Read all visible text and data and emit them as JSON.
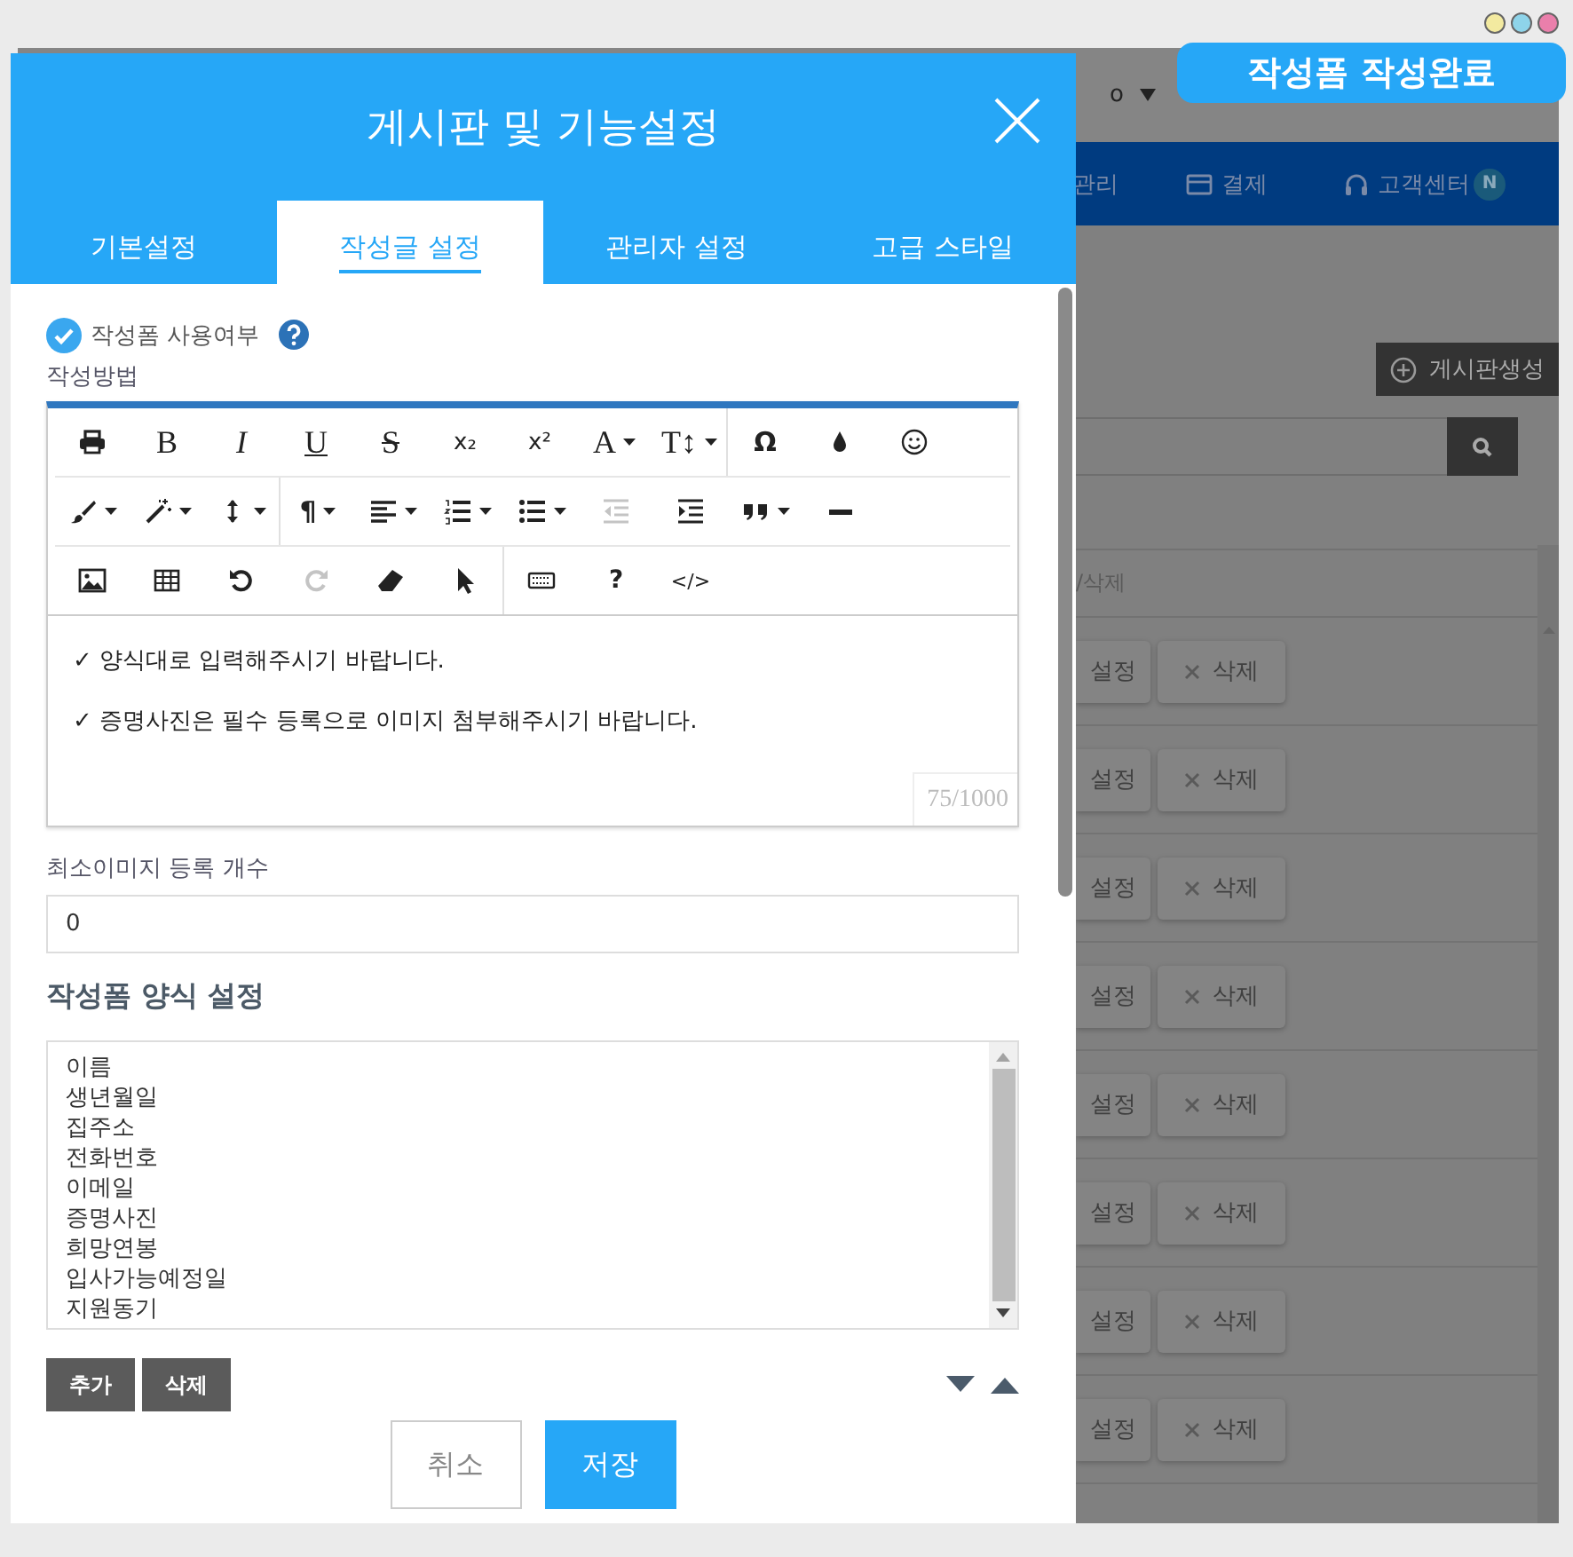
{
  "window_dots": [
    {
      "color": "#f3eaa0"
    },
    {
      "color": "#8ed4ea"
    },
    {
      "color": "#ea7fab"
    }
  ],
  "status_badge": "작성폼 작성완료",
  "background_page": {
    "top_text": "o",
    "nav": [
      {
        "label": "관리"
      },
      {
        "label": "결제"
      },
      {
        "label": "고객센터",
        "badge": "N"
      }
    ],
    "create_button": "게시판생성",
    "table_header": "/삭제",
    "rows": [
      {
        "edit": "설정",
        "delete": "삭제"
      },
      {
        "edit": "설정",
        "delete": "삭제"
      },
      {
        "edit": "설정",
        "delete": "삭제"
      },
      {
        "edit": "설정",
        "delete": "삭제"
      },
      {
        "edit": "설정",
        "delete": "삭제"
      },
      {
        "edit": "설정",
        "delete": "삭제"
      },
      {
        "edit": "설정",
        "delete": "삭제"
      },
      {
        "edit": "설정",
        "delete": "삭제"
      }
    ]
  },
  "modal": {
    "title": "게시판 및 기능설정",
    "tabs": [
      {
        "label": "기본설정",
        "selected": false
      },
      {
        "label": "작성글 설정",
        "selected": true
      },
      {
        "label": "관리자 설정",
        "selected": false
      },
      {
        "label": "고급 스타일",
        "selected": false
      }
    ],
    "use_form": {
      "label": "작성폼 사용여부",
      "checked": true
    },
    "method_label": "작성방법",
    "toolbar": [
      [
        [
          {
            "kind": "icon",
            "dropdown": false,
            "disabled": false
          },
          {
            "kind": "glyph",
            "text": "B",
            "dropdown": false,
            "disabled": false
          },
          {
            "kind": "glyph",
            "text": "I",
            "dropdown": false,
            "disabled": false
          },
          {
            "kind": "glyph",
            "text": "U",
            "dropdown": false,
            "disabled": false
          },
          {
            "kind": "glyph",
            "text": "S",
            "dropdown": false,
            "disabled": false
          },
          {
            "kind": "glyph",
            "text": "x₂",
            "dropdown": false,
            "disabled": false
          },
          {
            "kind": "glyph",
            "text": "x²",
            "dropdown": false,
            "disabled": false
          },
          {
            "kind": "glyph",
            "text": "A",
            "dropdown": true,
            "disabled": false
          },
          {
            "kind": "glyph",
            "text": "T↕",
            "dropdown": true,
            "disabled": false
          }
        ],
        [
          {
            "kind": "glyph",
            "text": "Ω",
            "dropdown": false,
            "disabled": false
          },
          {
            "kind": "icon",
            "dropdown": false,
            "disabled": false
          },
          {
            "kind": "icon",
            "dropdown": false,
            "disabled": false
          }
        ]
      ],
      [
        [
          {
            "kind": "icon",
            "dropdown": true,
            "disabled": false
          },
          {
            "kind": "icon",
            "dropdown": true,
            "disabled": false
          },
          {
            "kind": "icon",
            "dropdown": true,
            "disabled": false
          }
        ],
        [
          {
            "kind": "glyph",
            "text": "¶",
            "dropdown": true,
            "disabled": false
          },
          {
            "kind": "icon",
            "dropdown": true,
            "disabled": false
          },
          {
            "kind": "icon",
            "dropdown": true,
            "disabled": false
          },
          {
            "kind": "icon",
            "dropdown": true,
            "disabled": false
          },
          {
            "kind": "icon",
            "dropdown": false,
            "disabled": true
          },
          {
            "kind": "icon",
            "dropdown": false,
            "disabled": false
          },
          {
            "kind": "icon",
            "dropdown": true,
            "disabled": false
          },
          {
            "kind": "icon",
            "dropdown": false,
            "disabled": false
          }
        ]
      ],
      [
        [
          {
            "kind": "icon",
            "dropdown": false,
            "disabled": false
          },
          {
            "kind": "icon",
            "dropdown": false,
            "disabled": false
          },
          {
            "kind": "icon",
            "dropdown": false,
            "disabled": false
          },
          {
            "kind": "icon",
            "dropdown": false,
            "disabled": true
          },
          {
            "kind": "icon",
            "dropdown": false,
            "disabled": false
          },
          {
            "kind": "icon",
            "dropdown": false,
            "disabled": false
          }
        ],
        [
          {
            "kind": "icon",
            "dropdown": false,
            "disabled": false
          },
          {
            "kind": "glyph",
            "text": "?",
            "dropdown": false,
            "disabled": false
          },
          {
            "kind": "glyph",
            "text": "</>",
            "dropdown": false,
            "disabled": false
          }
        ]
      ]
    ],
    "editor_lines": [
      "✓ 양식대로 입력해주시기 바랍니다.",
      "✓ 증명사진은 필수 등록으로 이미지 첨부해주시기 바랍니다."
    ],
    "counter": "75/1000",
    "min_images": {
      "label": "최소이미지 등록 개수",
      "value": "0"
    },
    "form_section": {
      "title": "작성폼 양식 설정",
      "items": [
        "이름",
        "생년월일",
        "집주소",
        "전화번호",
        "이메일",
        "증명사진",
        "희망연봉",
        "입사가능예정일",
        "지원동기"
      ],
      "buttons": [
        "추가",
        "삭제"
      ]
    },
    "actions": [
      {
        "label": "취소",
        "kind": "secondary"
      },
      {
        "label": "저장",
        "kind": "primary"
      }
    ]
  }
}
